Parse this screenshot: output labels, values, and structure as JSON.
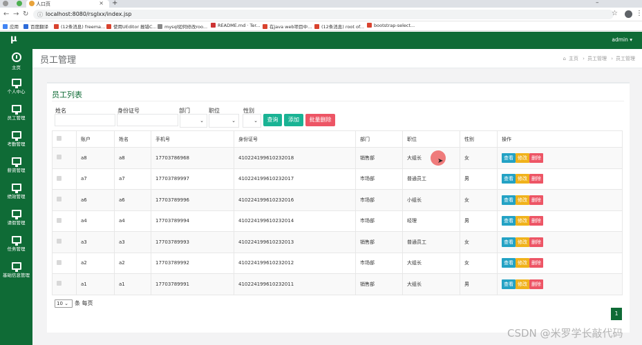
{
  "browser": {
    "tab_title": "人口页",
    "url": "localhost:8080/rsglxx/index.jsp",
    "bookmarks": [
      "应用",
      "百度翻译",
      "(12条消息) freema...",
      "使用UEditor 报错C...",
      "mysql如何修改roo...",
      "README.md · Ter...",
      "在java web项目中...",
      "(12条消息) root of...",
      "bootstrap-select..."
    ]
  },
  "app": {
    "logo": "μ",
    "user": "admin ▾",
    "page_title": "员工管理",
    "breadcrumb": [
      "主页",
      "员工管理",
      "员工管理"
    ]
  },
  "sidebar": {
    "items": [
      {
        "label": "主页",
        "icon": "dashboard-icon"
      },
      {
        "label": "个人中心",
        "icon": "monitor-icon"
      },
      {
        "label": "员工管理",
        "icon": "monitor-icon"
      },
      {
        "label": "考勤管理",
        "icon": "monitor-icon"
      },
      {
        "label": "薪资管理",
        "icon": "monitor-icon"
      },
      {
        "label": "绩效管理",
        "icon": "monitor-icon"
      },
      {
        "label": "请假管理",
        "icon": "monitor-icon"
      },
      {
        "label": "任务管理",
        "icon": "monitor-icon"
      },
      {
        "label": "基础信息管理",
        "icon": "monitor-icon"
      }
    ]
  },
  "panel": {
    "title": "员工列表",
    "filters": {
      "name_label": "姓名",
      "id_label": "身份证号",
      "dept_label": "部门",
      "position_label": "职位",
      "gender_label": "性别"
    },
    "buttons": {
      "search": "查询",
      "add": "添加",
      "batch_delete": "批量删除"
    },
    "columns": [
      "账户",
      "姓名",
      "手机号",
      "身份证号",
      "部门",
      "职位",
      "性别",
      "操作"
    ],
    "rows": [
      {
        "account": "a8",
        "name": "a8",
        "phone": "17703786968",
        "id": "410224199610232018",
        "dept": "销售部",
        "position": "大组长",
        "gender": "女"
      },
      {
        "account": "a7",
        "name": "a7",
        "phone": "17703789997",
        "id": "410224199610232017",
        "dept": "市场部",
        "position": "普通员工",
        "gender": "男"
      },
      {
        "account": "a6",
        "name": "a6",
        "phone": "17703789996",
        "id": "410224199610232016",
        "dept": "市场部",
        "position": "小组长",
        "gender": "女"
      },
      {
        "account": "a4",
        "name": "a4",
        "phone": "17703789994",
        "id": "410224199610232014",
        "dept": "市场部",
        "position": "经理",
        "gender": "男"
      },
      {
        "account": "a3",
        "name": "a3",
        "phone": "17703789993",
        "id": "410224199610232013",
        "dept": "销售部",
        "position": "普通员工",
        "gender": "女"
      },
      {
        "account": "a2",
        "name": "a2",
        "phone": "17703789992",
        "id": "410224199610232012",
        "dept": "市场部",
        "position": "大组长",
        "gender": "女"
      },
      {
        "account": "a1",
        "name": "a1",
        "phone": "17703789991",
        "id": "410224199610232011",
        "dept": "销售部",
        "position": "大组长",
        "gender": "男"
      }
    ],
    "row_actions": {
      "view": "查看",
      "edit": "修改",
      "delete": "删除"
    },
    "page_size": "10",
    "page_size_suffix": "条 每页",
    "current_page": "1"
  },
  "watermark": "CSDN @米罗学长敲代码",
  "colors": {
    "primary": "#0f6b36",
    "info": "#23a2c4",
    "warning": "#f0b21b",
    "danger": "#ed5565",
    "success": "#1ab394"
  }
}
